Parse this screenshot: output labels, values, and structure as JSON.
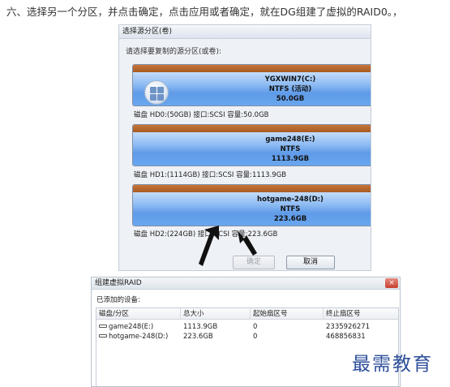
{
  "instruction": "六、选择另一个分区，并点击确定，点击应用或者确定，就在DG组建了虚拟的RAID0。，",
  "select_dialog": {
    "title": "选择源分区(卷)",
    "prompt": "请选择要复制的源分区(或卷):",
    "disks": [
      {
        "name": "YGXWIN7(C:)",
        "fs": "NTFS (活动)",
        "size": "50.0GB",
        "info": "磁盘 HD0:(50GB)  接口:SCSI  容量:50.0GB",
        "has_os_icon": true,
        "icon": "windows-logo-icon"
      },
      {
        "name": "game248(E:)",
        "fs": "NTFS",
        "size": "1113.9GB",
        "info": "磁盘 HD1:(1114GB)  接口:SCSI  容量:1113.9GB",
        "has_os_icon": false
      },
      {
        "name": "hotgame-248(D:)",
        "fs": "NTFS",
        "size": "223.6GB",
        "info": "磁盘 HD2:(224GB)  接口:SCSI  容量:223.6GB",
        "has_os_icon": false
      }
    ],
    "ok_label": "确定",
    "cancel_label": "取消",
    "annotation": "arrow-pointer-icon"
  },
  "raid_dialog": {
    "title": "组建虚拟RAID",
    "close_label": "×",
    "added_label": "已添加的设备:",
    "columns": [
      "磁盘/分区",
      "总大小",
      "起始扇区号",
      "终止扇区号"
    ],
    "rows": [
      {
        "name": "game248(E:)",
        "total": "1113.9GB",
        "start": "0",
        "end": "2335926271"
      },
      {
        "name": "hotgame-248(D:)",
        "total": "223.6GB",
        "start": "0",
        "end": "468856831"
      }
    ]
  },
  "watermark": "最需教育",
  "colors": {
    "disk_cap": "#b5652b",
    "disk_body": "#6aa8f0",
    "watermark": "#2e4f9a"
  }
}
